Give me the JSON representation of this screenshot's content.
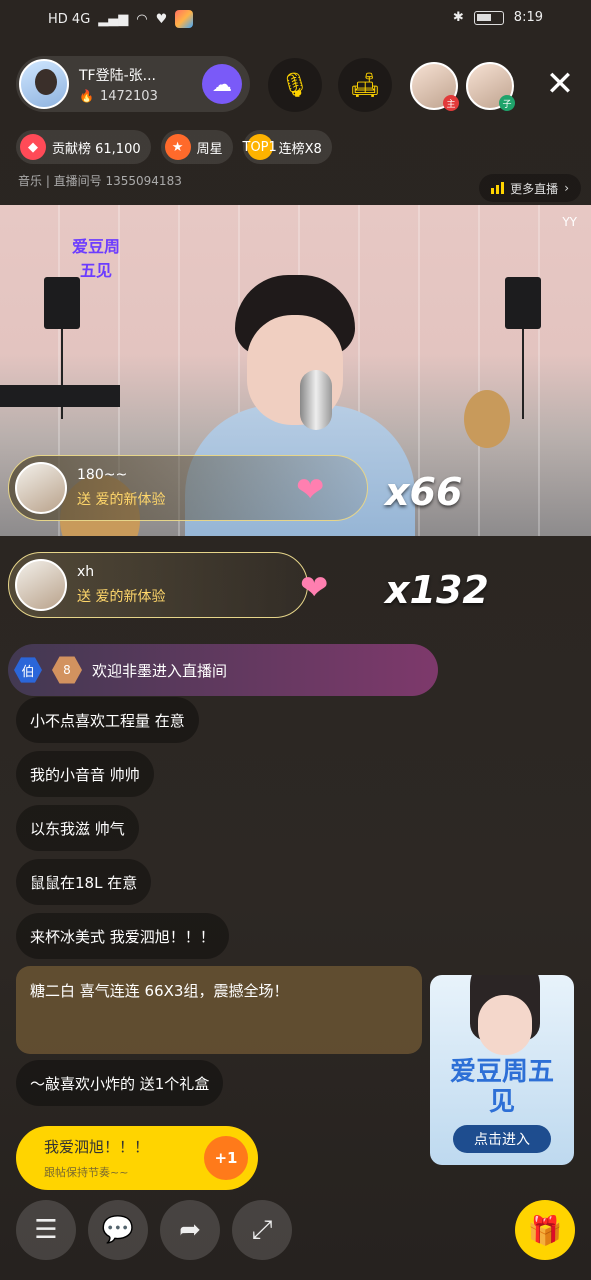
{
  "status_bar": {
    "left_text": "HD 4G",
    "time": "8:19"
  },
  "host": {
    "name": "TF登陆-张...",
    "fans": "1472103"
  },
  "viewers": [
    {
      "tag": "主"
    },
    {
      "tag": "子"
    }
  ],
  "tags": {
    "contribution": "贡献榜 61,100",
    "weekly": "周星",
    "top_badge": "TOP1",
    "streak": "连榜X8"
  },
  "room_line": "音乐 | 直播间号 1355094183",
  "more_live": "更多直播",
  "video_logo": "爱豆周五见",
  "video_watermark": "YY",
  "gifts": [
    {
      "line1": "180~~",
      "line2": "送 爱的新体验",
      "count": "x66"
    },
    {
      "line1": "xh",
      "line2": "送 爱的新体验",
      "count": "x132"
    }
  ],
  "welcome": {
    "badge": "伯",
    "level": "8",
    "text": "欢迎非墨进入直播间"
  },
  "chat_messages": [
    "小不点喜欢工程量 在意",
    "我的小音音 帅帅",
    "以东我滋 帅气",
    "鼠鼠在18L 在意",
    "来杯冰美式 我爱泗旭！！！",
    "糖二白 喜气连连 66X3组，震撼全场！",
    "～敲喜欢小炸的 送1个礼盒"
  ],
  "quick_reply": {
    "text": "我爱泗旭！！！",
    "sub": "跟帖保持节奏~~",
    "plus": "+1"
  },
  "promo": {
    "title": "爱豆周五见",
    "button": "点击进入"
  }
}
